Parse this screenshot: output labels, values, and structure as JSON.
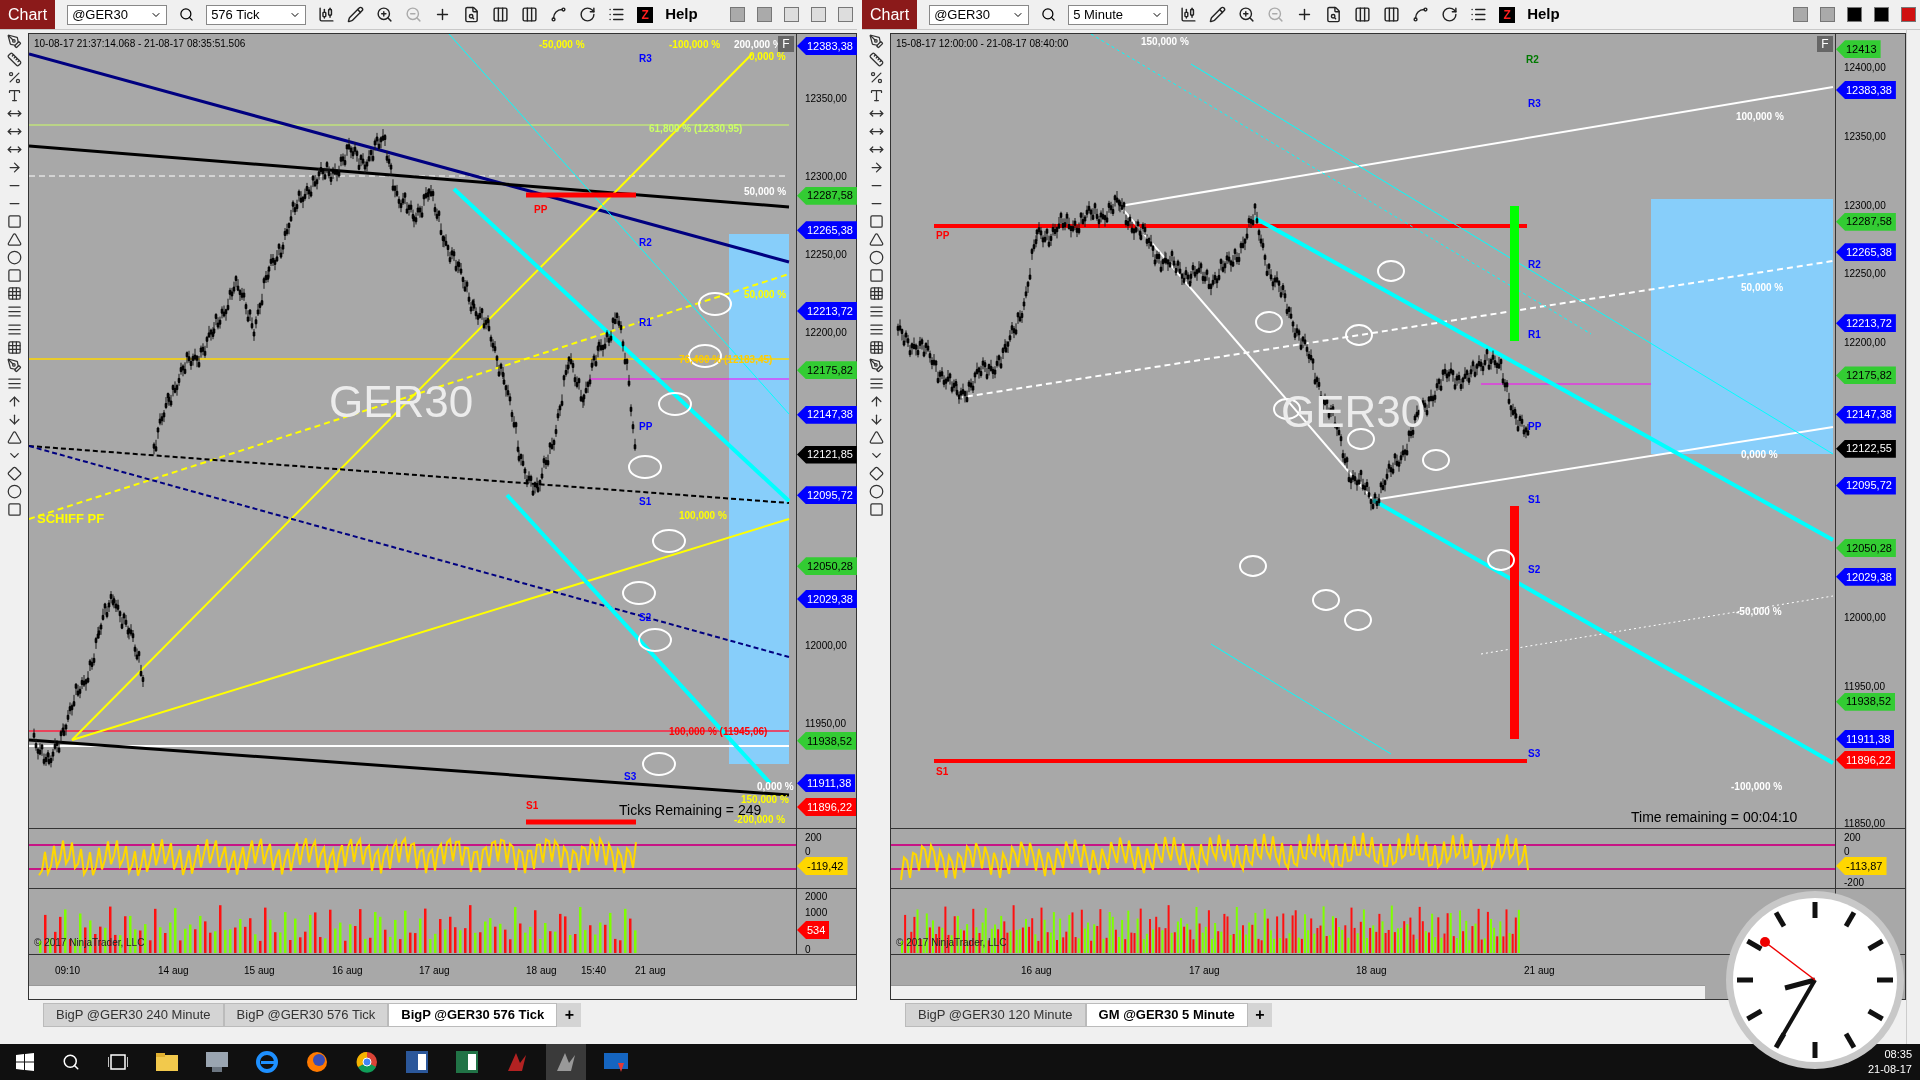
{
  "charts": [
    {
      "menu_label": "Chart",
      "instrument": "@GER30",
      "interval": "576 Tick",
      "z_label": "Z",
      "help": "Help",
      "f_label": "F",
      "date_range": "10-08-17 21:37:14.068 - 21-08-17 08:35:51.506",
      "watermark": "GER30",
      "annotations": [
        {
          "text": "-50,000 %",
          "color": "#ffff00"
        },
        {
          "text": "-100,000 %",
          "color": "#ffff00"
        },
        {
          "text": "200,000 %",
          "color": "#ffffff"
        },
        {
          "text": "0,000 %",
          "color": "#ffff00"
        },
        {
          "text": "R3",
          "color": "#0000ff"
        },
        {
          "text": "61,800 % (12330,95)",
          "color": "#ccff66"
        },
        {
          "text": "50,000 %",
          "color": "#ffffff"
        },
        {
          "text": "PP",
          "color": "#ff0000"
        },
        {
          "text": "R2",
          "color": "#0000ff"
        },
        {
          "text": "50,000 %",
          "color": "#ffff00"
        },
        {
          "text": "R1",
          "color": "#0000ff"
        },
        {
          "text": "76,400 % (12183,45)",
          "color": "#ffcc00"
        },
        {
          "text": "PP",
          "color": "#0000ff"
        },
        {
          "text": "S1",
          "color": "#0000ff"
        },
        {
          "text": "100,000 %",
          "color": "#ffff00"
        },
        {
          "text": "S2",
          "color": "#0000ff"
        },
        {
          "text": "SCHIFF PF",
          "color": "#ffff00"
        },
        {
          "text": "100,000 % (11945,06)",
          "color": "#ff0000"
        },
        {
          "text": "0,000 %",
          "color": "#ffffff"
        },
        {
          "text": "150,000 %",
          "color": "#ffff00"
        },
        {
          "text": "S3",
          "color": "#0000ff"
        },
        {
          "text": "S1",
          "color": "#ff0000"
        },
        {
          "text": "Ticks Remaining = 249",
          "color": "#000000"
        },
        {
          "text": "-200,000 %",
          "color": "#ffff00"
        }
      ],
      "price_ticks": [
        "12350,00",
        "12300,00",
        "12250,00",
        "12200,00",
        "12000,00",
        "11950,00"
      ],
      "price_tags": [
        {
          "text": "12383,38",
          "color": "#0000ff"
        },
        {
          "text": "12287,58",
          "color": "#33cc33"
        },
        {
          "text": "12265,38",
          "color": "#0000ff"
        },
        {
          "text": "12213,72",
          "color": "#0000ff"
        },
        {
          "text": "12175,82",
          "color": "#33cc33"
        },
        {
          "text": "12147,38",
          "color": "#0000ff"
        },
        {
          "text": "12121,85",
          "color": "#000000"
        },
        {
          "text": "12095,72",
          "color": "#0000ff"
        },
        {
          "text": "12050,28",
          "color": "#33cc33"
        },
        {
          "text": "12029,38",
          "color": "#0000ff"
        },
        {
          "text": "11938,52",
          "color": "#33cc33"
        },
        {
          "text": "11911,38",
          "color": "#0000ff"
        },
        {
          "text": "11896,22",
          "color": "#ff0000"
        }
      ],
      "indicator": {
        "ticks": [
          "200",
          "0"
        ],
        "tag": {
          "text": "-119,42",
          "color": "#ffd700"
        }
      },
      "volume": {
        "ticks": [
          "2000",
          "1000",
          "0"
        ],
        "tag": {
          "text": "534",
          "color": "#ff0000"
        },
        "copyright": "© 2017 NinjaTrader, LLC"
      },
      "time_labels": [
        "09:10",
        "14 aug",
        "15 aug",
        "16 aug",
        "17 aug",
        "18 aug",
        "15:40",
        "21 aug"
      ],
      "tabs": [
        {
          "label": "BigP @GER30 240 Minute",
          "selected": false
        },
        {
          "label": "BigP @GER30 576 Tick",
          "selected": false
        },
        {
          "label": "BigP @GER30 576 Tick",
          "selected": true
        }
      ],
      "add_tab": "+"
    },
    {
      "menu_label": "Chart",
      "instrument": "@GER30",
      "interval": "5 Minute",
      "z_label": "Z",
      "help": "Help",
      "f_label": "F",
      "date_range": "15-08-17 12:00:00 - 21-08-17 08:40:00",
      "watermark": "GER30",
      "annotations": [
        {
          "text": "150,000 %",
          "color": "#ffffff"
        },
        {
          "text": "R2",
          "color": "#007a00"
        },
        {
          "text": "R3",
          "color": "#0000ff"
        },
        {
          "text": "100,000 %",
          "color": "#ffffff"
        },
        {
          "text": "PP",
          "color": "#ff0000"
        },
        {
          "text": "R2",
          "color": "#0000ff"
        },
        {
          "text": "50,000 %",
          "color": "#ffffff"
        },
        {
          "text": "R1",
          "color": "#0000ff"
        },
        {
          "text": "PP",
          "color": "#0000ff"
        },
        {
          "text": "0,000 %",
          "color": "#ffffff"
        },
        {
          "text": "S1",
          "color": "#0000ff"
        },
        {
          "text": "S2",
          "color": "#0000ff"
        },
        {
          "text": "-50,000 %",
          "color": "#ffffff"
        },
        {
          "text": "S3",
          "color": "#0000ff"
        },
        {
          "text": "S1",
          "color": "#ff0000"
        },
        {
          "text": "-100,000 %",
          "color": "#ffffff"
        },
        {
          "text": "Time remaining = 00:04:10",
          "color": "#000000"
        }
      ],
      "price_ticks": [
        "12400,00",
        "12350,00",
        "12300,00",
        "12250,00",
        "12200,00",
        "12000,00",
        "11950,00",
        "11850,00"
      ],
      "price_tags": [
        {
          "text": "12413",
          "color": "#33cc33"
        },
        {
          "text": "12383,38",
          "color": "#0000ff"
        },
        {
          "text": "12287,58",
          "color": "#33cc33"
        },
        {
          "text": "12265,38",
          "color": "#0000ff"
        },
        {
          "text": "12213,72",
          "color": "#0000ff"
        },
        {
          "text": "12175,82",
          "color": "#33cc33"
        },
        {
          "text": "12147,38",
          "color": "#0000ff"
        },
        {
          "text": "12122,55",
          "color": "#000000"
        },
        {
          "text": "12095,72",
          "color": "#0000ff"
        },
        {
          "text": "12050,28",
          "color": "#33cc33"
        },
        {
          "text": "12029,38",
          "color": "#0000ff"
        },
        {
          "text": "11938,52",
          "color": "#33cc33"
        },
        {
          "text": "11911,38",
          "color": "#0000ff"
        },
        {
          "text": "11896,22",
          "color": "#ff0000"
        }
      ],
      "indicator": {
        "ticks": [
          "200",
          "0",
          "-200"
        ],
        "tag": {
          "text": "-113,87",
          "color": "#ffd700"
        }
      },
      "volume": {
        "copyright": "© 2017 NinjaTrader, LLC"
      },
      "time_labels": [
        "16 aug",
        "17 aug",
        "18 aug",
        "21 aug"
      ],
      "tabs": [
        {
          "label": "BigP @GER30 120 Minute",
          "selected": false
        },
        {
          "label": "GM @GER30 5 Minute",
          "selected": true
        }
      ],
      "add_tab": "+"
    }
  ],
  "tray": {
    "time": "08:35",
    "date": "21-08-17"
  }
}
